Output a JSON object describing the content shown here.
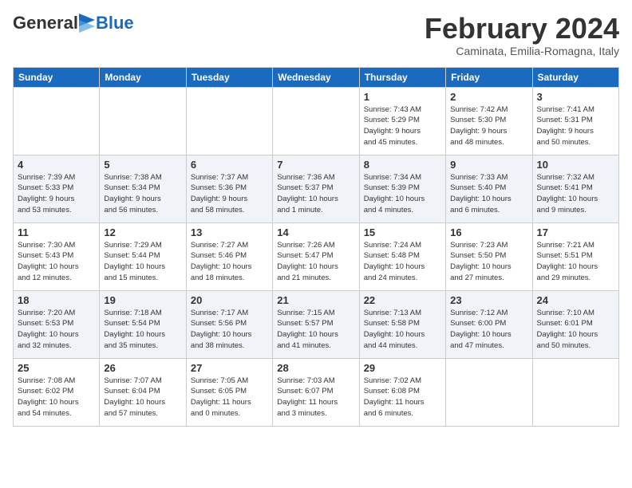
{
  "header": {
    "logo_general": "General",
    "logo_blue": "Blue",
    "month_title": "February 2024",
    "subtitle": "Caminata, Emilia-Romagna, Italy"
  },
  "days_of_week": [
    "Sunday",
    "Monday",
    "Tuesday",
    "Wednesday",
    "Thursday",
    "Friday",
    "Saturday"
  ],
  "weeks": [
    [
      {
        "day": "",
        "info": ""
      },
      {
        "day": "",
        "info": ""
      },
      {
        "day": "",
        "info": ""
      },
      {
        "day": "",
        "info": ""
      },
      {
        "day": "1",
        "info": "Sunrise: 7:43 AM\nSunset: 5:29 PM\nDaylight: 9 hours\nand 45 minutes."
      },
      {
        "day": "2",
        "info": "Sunrise: 7:42 AM\nSunset: 5:30 PM\nDaylight: 9 hours\nand 48 minutes."
      },
      {
        "day": "3",
        "info": "Sunrise: 7:41 AM\nSunset: 5:31 PM\nDaylight: 9 hours\nand 50 minutes."
      }
    ],
    [
      {
        "day": "4",
        "info": "Sunrise: 7:39 AM\nSunset: 5:33 PM\nDaylight: 9 hours\nand 53 minutes."
      },
      {
        "day": "5",
        "info": "Sunrise: 7:38 AM\nSunset: 5:34 PM\nDaylight: 9 hours\nand 56 minutes."
      },
      {
        "day": "6",
        "info": "Sunrise: 7:37 AM\nSunset: 5:36 PM\nDaylight: 9 hours\nand 58 minutes."
      },
      {
        "day": "7",
        "info": "Sunrise: 7:36 AM\nSunset: 5:37 PM\nDaylight: 10 hours\nand 1 minute."
      },
      {
        "day": "8",
        "info": "Sunrise: 7:34 AM\nSunset: 5:39 PM\nDaylight: 10 hours\nand 4 minutes."
      },
      {
        "day": "9",
        "info": "Sunrise: 7:33 AM\nSunset: 5:40 PM\nDaylight: 10 hours\nand 6 minutes."
      },
      {
        "day": "10",
        "info": "Sunrise: 7:32 AM\nSunset: 5:41 PM\nDaylight: 10 hours\nand 9 minutes."
      }
    ],
    [
      {
        "day": "11",
        "info": "Sunrise: 7:30 AM\nSunset: 5:43 PM\nDaylight: 10 hours\nand 12 minutes."
      },
      {
        "day": "12",
        "info": "Sunrise: 7:29 AM\nSunset: 5:44 PM\nDaylight: 10 hours\nand 15 minutes."
      },
      {
        "day": "13",
        "info": "Sunrise: 7:27 AM\nSunset: 5:46 PM\nDaylight: 10 hours\nand 18 minutes."
      },
      {
        "day": "14",
        "info": "Sunrise: 7:26 AM\nSunset: 5:47 PM\nDaylight: 10 hours\nand 21 minutes."
      },
      {
        "day": "15",
        "info": "Sunrise: 7:24 AM\nSunset: 5:48 PM\nDaylight: 10 hours\nand 24 minutes."
      },
      {
        "day": "16",
        "info": "Sunrise: 7:23 AM\nSunset: 5:50 PM\nDaylight: 10 hours\nand 27 minutes."
      },
      {
        "day": "17",
        "info": "Sunrise: 7:21 AM\nSunset: 5:51 PM\nDaylight: 10 hours\nand 29 minutes."
      }
    ],
    [
      {
        "day": "18",
        "info": "Sunrise: 7:20 AM\nSunset: 5:53 PM\nDaylight: 10 hours\nand 32 minutes."
      },
      {
        "day": "19",
        "info": "Sunrise: 7:18 AM\nSunset: 5:54 PM\nDaylight: 10 hours\nand 35 minutes."
      },
      {
        "day": "20",
        "info": "Sunrise: 7:17 AM\nSunset: 5:56 PM\nDaylight: 10 hours\nand 38 minutes."
      },
      {
        "day": "21",
        "info": "Sunrise: 7:15 AM\nSunset: 5:57 PM\nDaylight: 10 hours\nand 41 minutes."
      },
      {
        "day": "22",
        "info": "Sunrise: 7:13 AM\nSunset: 5:58 PM\nDaylight: 10 hours\nand 44 minutes."
      },
      {
        "day": "23",
        "info": "Sunrise: 7:12 AM\nSunset: 6:00 PM\nDaylight: 10 hours\nand 47 minutes."
      },
      {
        "day": "24",
        "info": "Sunrise: 7:10 AM\nSunset: 6:01 PM\nDaylight: 10 hours\nand 50 minutes."
      }
    ],
    [
      {
        "day": "25",
        "info": "Sunrise: 7:08 AM\nSunset: 6:02 PM\nDaylight: 10 hours\nand 54 minutes."
      },
      {
        "day": "26",
        "info": "Sunrise: 7:07 AM\nSunset: 6:04 PM\nDaylight: 10 hours\nand 57 minutes."
      },
      {
        "day": "27",
        "info": "Sunrise: 7:05 AM\nSunset: 6:05 PM\nDaylight: 11 hours\nand 0 minutes."
      },
      {
        "day": "28",
        "info": "Sunrise: 7:03 AM\nSunset: 6:07 PM\nDaylight: 11 hours\nand 3 minutes."
      },
      {
        "day": "29",
        "info": "Sunrise: 7:02 AM\nSunset: 6:08 PM\nDaylight: 11 hours\nand 6 minutes."
      },
      {
        "day": "",
        "info": ""
      },
      {
        "day": "",
        "info": ""
      }
    ]
  ]
}
